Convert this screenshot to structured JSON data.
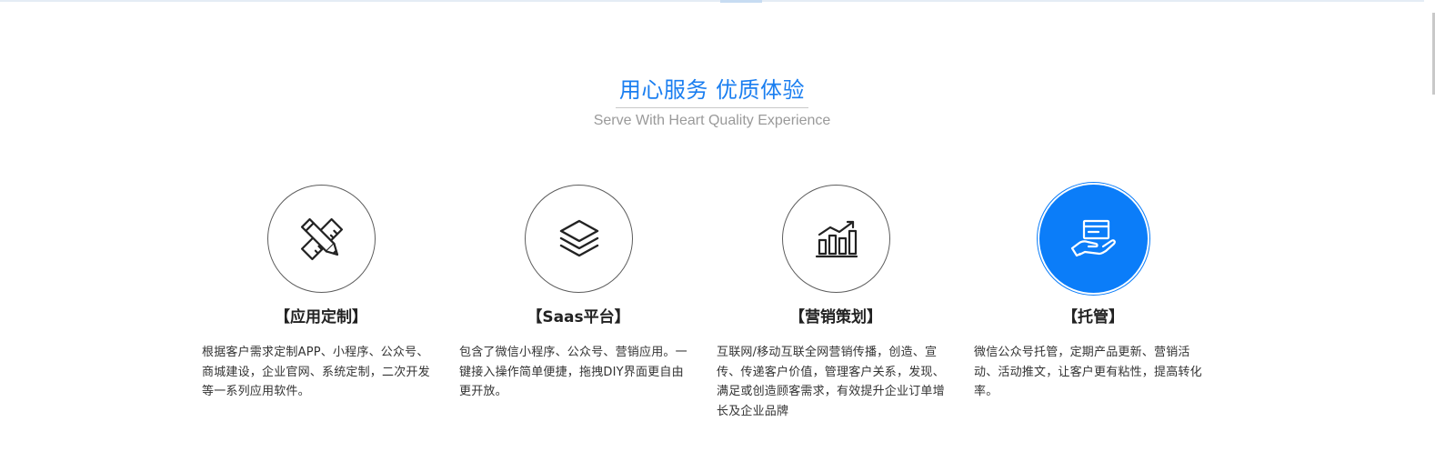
{
  "header": {
    "title": "用心服务 优质体验",
    "subtitle": "Serve With Heart Quality Experience"
  },
  "services": [
    {
      "icon": "pencil-ruler-icon",
      "title": "【应用定制】",
      "description": "根据客户需求定制APP、小程序、公众号、商城建设，企业官网、系统定制，二次开发等一系列应用软件。"
    },
    {
      "icon": "layers-icon",
      "title": "【Saas平台】",
      "description": "包含了微信小程序、公众号、营销应用。一键接入操作简单便捷，拖拽DIY界面更自由更开放。"
    },
    {
      "icon": "growth-chart-icon",
      "title": "【营销策划】",
      "description": "互联网/移动互联全网营销传播，创造、宣传、传递客户价值，管理客户关系，发现、满足或创造顾客需求，有效提升企业订单增长及企业品牌"
    },
    {
      "icon": "hand-card-icon",
      "title": "【托管】",
      "description": "微信公众号托管，定期产品更新、营销活动、活动推文，让客户更有粘性，提高转化率。"
    }
  ],
  "colors": {
    "accent": "#0b7df9",
    "title_blue": "#1a7ef0",
    "subtitle_gray": "#9a9a9a",
    "text": "#333333"
  }
}
